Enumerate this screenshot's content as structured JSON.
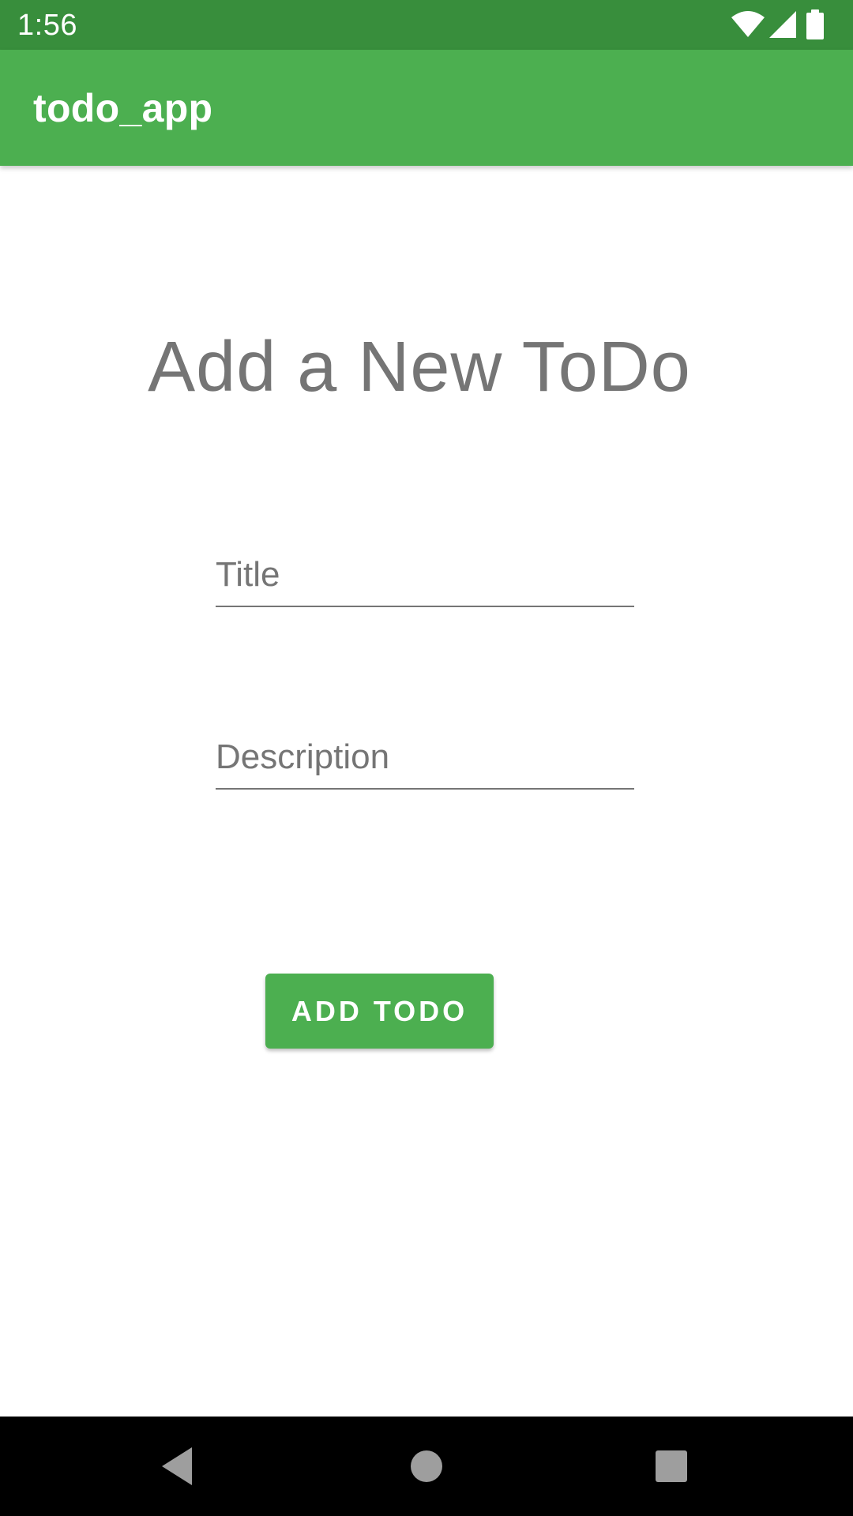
{
  "status_bar": {
    "time": "1:56",
    "icons": [
      "wifi-icon",
      "signal-icon",
      "battery-icon"
    ]
  },
  "app_bar": {
    "title": "todo_app",
    "color": "#4caf50"
  },
  "main": {
    "heading": "Add a New ToDo",
    "title_field": {
      "placeholder": "Title",
      "value": ""
    },
    "description_field": {
      "placeholder": "Description",
      "value": ""
    },
    "add_button_label": "ADD TODO"
  },
  "nav_bar": {
    "buttons": [
      "back-icon",
      "home-icon",
      "recents-icon"
    ]
  },
  "colors": {
    "status_bar": "#388e3c",
    "primary": "#4caf50",
    "text_muted": "#757575"
  }
}
